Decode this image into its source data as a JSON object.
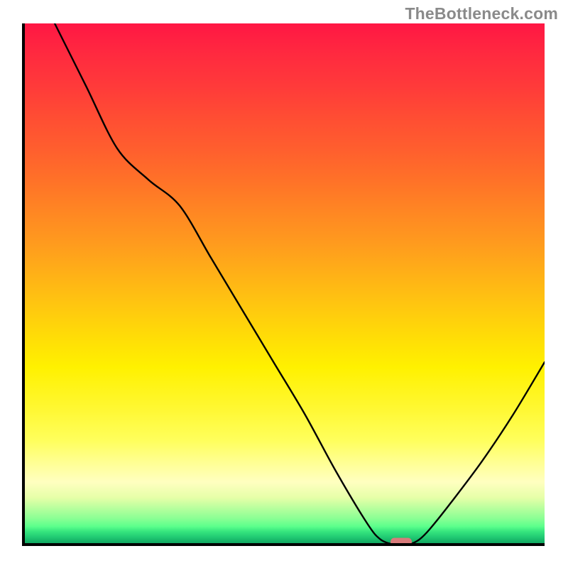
{
  "watermark": "TheBottleneck.com",
  "chart_data": {
    "type": "line",
    "title": "",
    "xlabel": "",
    "ylabel": "",
    "x_range": [
      0,
      100
    ],
    "y_range": [
      0,
      100
    ],
    "series": [
      {
        "name": "curve",
        "x": [
          6,
          12,
          18,
          24,
          30,
          36,
          42,
          48,
          54,
          60,
          66,
          68.5,
          71,
          72.5,
          74,
          76,
          78,
          82,
          88,
          94,
          100
        ],
        "y": [
          100,
          88,
          76,
          70,
          65,
          55,
          45,
          35,
          25,
          14,
          4,
          1,
          0,
          0,
          0,
          1,
          3,
          8,
          16,
          25,
          35
        ]
      }
    ],
    "marker": {
      "x": 72.5,
      "y": 0,
      "shape": "rounded-pill",
      "color": "#d97b7b"
    },
    "background": "vertical-rainbow-heatmap",
    "colors": {
      "top": "#ff1744",
      "mid": "#fff100",
      "bottom": "#0f9c5c"
    },
    "axes": {
      "visible_ticks": false,
      "frame_left_bottom_only": true
    }
  }
}
